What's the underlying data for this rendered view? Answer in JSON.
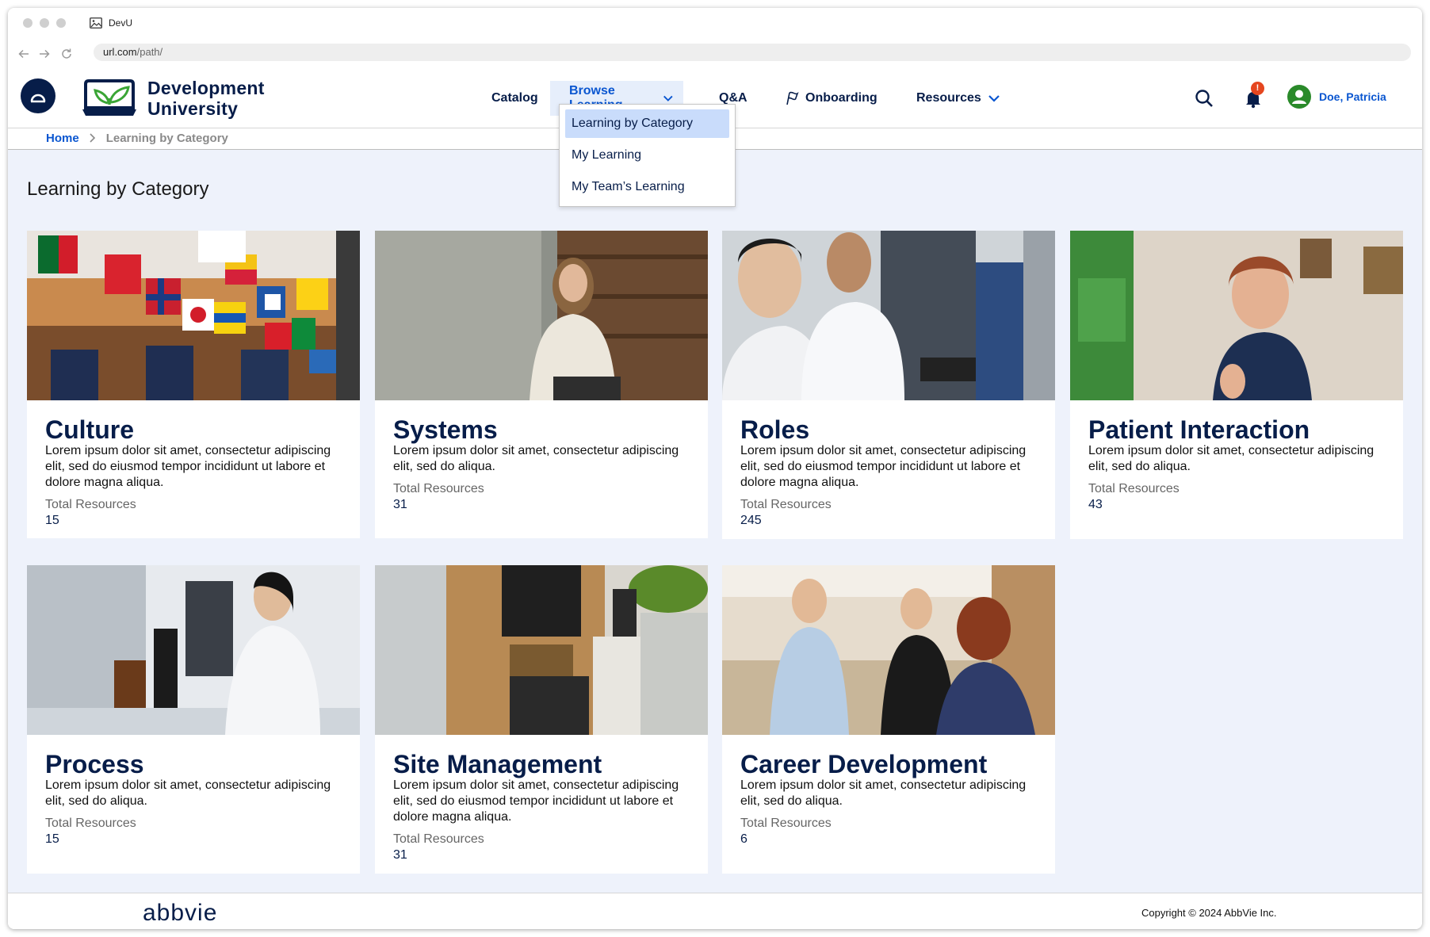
{
  "browser": {
    "tab_title": "DevU",
    "url_base": "url.com",
    "url_path": "/path/"
  },
  "site": {
    "name_line1": "Development",
    "name_line2": "University"
  },
  "nav": {
    "items": [
      {
        "label": "Catalog"
      },
      {
        "label": "Browse Learning"
      },
      {
        "label": "Q&A"
      },
      {
        "label": "Onboarding"
      },
      {
        "label": "Resources"
      }
    ],
    "active": "Browse Learning"
  },
  "notifications": {
    "badge": "!"
  },
  "user": {
    "name": "Doe, Patricia"
  },
  "dropdown": {
    "items": [
      {
        "label": "Learning by Category"
      },
      {
        "label": "My Learning"
      },
      {
        "label": "My Team’s Learning"
      }
    ],
    "selected": "Learning by Category"
  },
  "breadcrumb": {
    "home": "Home",
    "separator": ">",
    "current": "Learning by Category"
  },
  "page": {
    "title": "Learning by Category"
  },
  "categories": [
    {
      "title": "Culture",
      "desc": "Lorem ipsum dolor sit amet, consectetur adipiscing elit, sed do eiusmod tempor incididunt ut labore et dolore magna aliqua.",
      "total_label": "Total Resources",
      "total": "15",
      "image": "flags-hall-photo"
    },
    {
      "title": "Systems",
      "desc": "Lorem ipsum dolor sit amet, consectetur adipiscing elit, sed do  aliqua.",
      "total_label": "Total Resources",
      "total": "31",
      "image": "woman-laptop-photo"
    },
    {
      "title": "Roles",
      "desc": "Lorem ipsum dolor sit amet, consectetur adipiscing elit, sed do eiusmod tempor incididunt ut labore et dolore magna aliqua.",
      "total_label": "Total Resources",
      "total": "245",
      "image": "lab-workers-photo"
    },
    {
      "title": "Patient Interaction",
      "desc": "Lorem ipsum dolor sit amet, consectetur adipiscing elit, sed do  aliqua.",
      "total_label": "Total Resources",
      "total": "43",
      "image": "smiling-woman-photo"
    },
    {
      "title": "Process",
      "desc": "Lorem ipsum dolor sit amet, consectetur adipiscing elit, sed do  aliqua.",
      "total_label": "Total Resources",
      "total": "15",
      "image": "lab-scientist-photo"
    },
    {
      "title": "Site Management",
      "desc": "Lorem ipsum dolor sit amet, consectetur adipiscing elit, sed do eiusmod tempor incididunt ut labore et dolore magna aliqua.",
      "total_label": "Total Resources",
      "total": "31",
      "image": "office-cafe-photo"
    },
    {
      "title": "Career Development",
      "desc": "Lorem ipsum dolor sit amet, consectetur adipiscing elit, sed do  aliqua.",
      "total_label": "Total Resources",
      "total": "6",
      "image": "colleagues-talking-photo"
    }
  ],
  "footer": {
    "logo_text": "abbvie",
    "copyright": "Copyright © 2024 AbbVie Inc."
  },
  "colors": {
    "brand_navy": "#071d49",
    "link_blue": "#0a56d0",
    "active_nav_bg": "#e6eefb",
    "dropdown_selected_bg": "#c9dcfb",
    "main_bg": "#eef2fb",
    "badge_red": "#e5461f",
    "avatar_green": "#2a8a2a",
    "logo_green": "#3aa535"
  }
}
